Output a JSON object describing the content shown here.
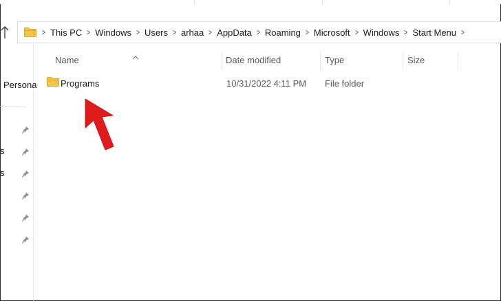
{
  "address_bar": {
    "breadcrumbs": [
      "This PC",
      "Windows",
      "Users",
      "arhaa",
      "AppData",
      "Roaming",
      "Microsoft",
      "Windows",
      "Start Menu"
    ]
  },
  "nav_pane": {
    "label": "Persona",
    "truncated": [
      "s",
      "s"
    ]
  },
  "columns": {
    "name": "Name",
    "date": "Date modified",
    "type": "Type",
    "size": "Size"
  },
  "rows": [
    {
      "name": "Programs",
      "date": "10/31/2022 4:11 PM",
      "type": "File folder",
      "size": ""
    }
  ],
  "colors": {
    "accent_arrow": "#e01b1b",
    "folder": "#f3c545",
    "folder_dark": "#e0a82e"
  }
}
